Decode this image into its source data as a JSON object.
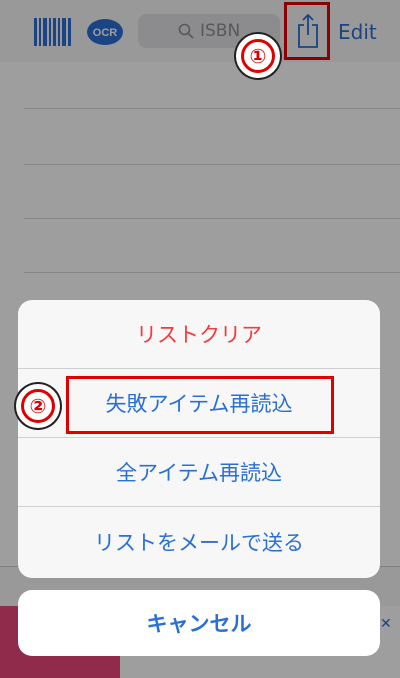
{
  "toolbar": {
    "search_placeholder": "ISBN",
    "edit_label": "Edit",
    "barcode_icon": "barcode-icon",
    "ocr_icon": "ocr-icon",
    "share_icon": "share-icon"
  },
  "callouts": {
    "first": "①",
    "second": "②"
  },
  "action_sheet": {
    "items": [
      {
        "label": "リストクリア",
        "style": "destructive"
      },
      {
        "label": "失敗アイテム再読込",
        "style": "normal"
      },
      {
        "label": "全アイテム再読込",
        "style": "normal"
      },
      {
        "label": "リストをメールで送る",
        "style": "normal"
      }
    ],
    "cancel_label": "キャンセル"
  },
  "colors": {
    "accent": "#2a6fd6",
    "destructive": "#f33b3b",
    "annotation": "#e00000"
  }
}
